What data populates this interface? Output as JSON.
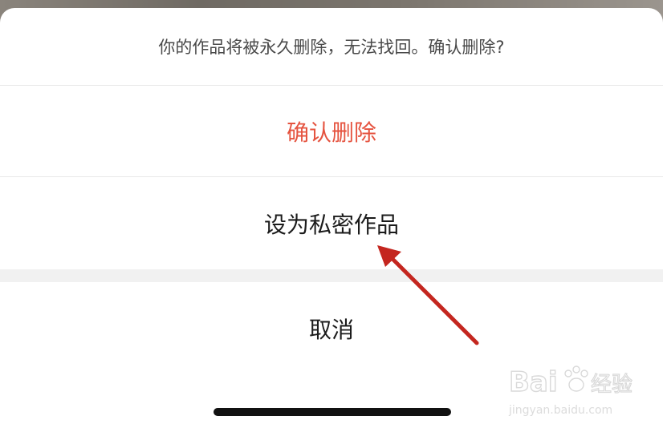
{
  "dialog": {
    "prompt": "你的作品将被永久删除，无法找回。确认删除?",
    "actions": {
      "confirm_delete": "确认删除",
      "set_private": "设为私密作品",
      "cancel": "取消"
    }
  },
  "watermark": {
    "brand": "Bai",
    "brand_suffix": "经验",
    "url": "jingyan.baidu.com"
  },
  "colors": {
    "danger": "#e5533f",
    "annotation_arrow": "#c4261f"
  }
}
